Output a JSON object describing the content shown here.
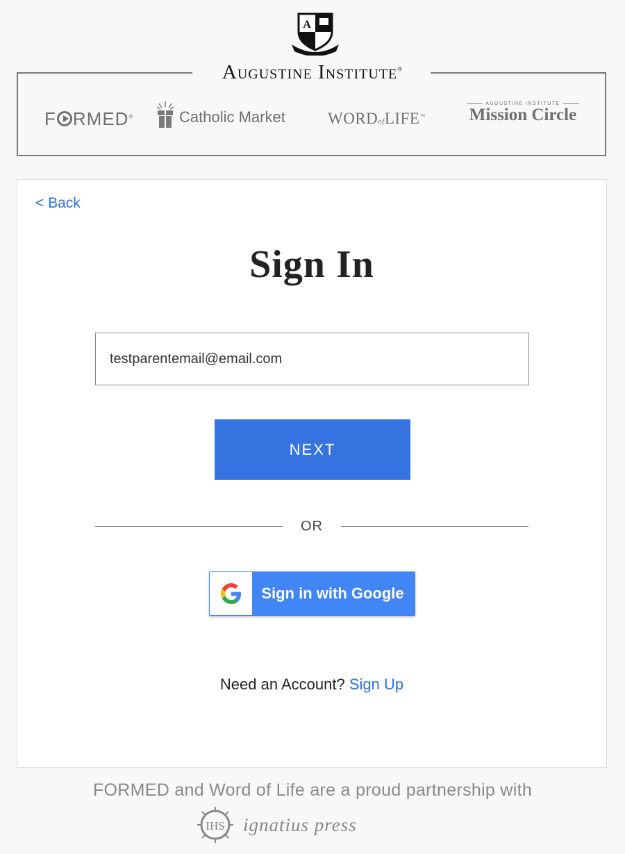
{
  "header": {
    "brand_title": "Augustine Institute",
    "brand_tm": "®",
    "logos": {
      "formed": {
        "pre": "F",
        "post": "RMED",
        "mark": "®"
      },
      "catholic_market": "Catholic Market",
      "word_of_life": {
        "word": "WORD",
        "of": "of",
        "life": "LIFE",
        "tm": "™"
      },
      "mission_circle": {
        "top": "AUGUSTINE INSTITUTE",
        "main": "Mission Circle"
      }
    }
  },
  "card": {
    "back_label": "< Back",
    "title": "Sign In",
    "email_value": "testparentemail@email.com",
    "next_label": "NEXT",
    "or_label": "OR",
    "google_label": "Sign in with Google",
    "need_account": "Need an Account?",
    "signup_label": "Sign Up"
  },
  "footer": {
    "partnership_text": "FORMED and Word of Life are a proud partnership with",
    "partner_name": "ignatius press"
  },
  "colors": {
    "primary": "#3574e0",
    "link": "#2f6fdc",
    "google_blue": "#4285f4"
  }
}
